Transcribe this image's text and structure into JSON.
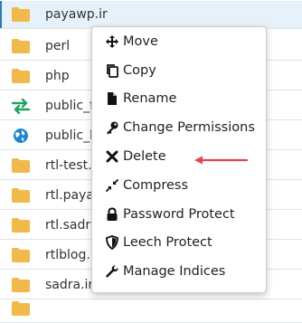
{
  "file_list": {
    "rows": [
      {
        "name": "payawp.ir",
        "icon": "folder-icon",
        "selected": true
      },
      {
        "name": "perl",
        "icon": "folder-icon"
      },
      {
        "name": "php",
        "icon": "folder-icon"
      },
      {
        "name": "public_f",
        "icon": "symlink-icon"
      },
      {
        "name": "public_h",
        "icon": "globe-icon"
      },
      {
        "name": "rtl-test.i",
        "icon": "folder-icon"
      },
      {
        "name": "rtl.paya",
        "icon": "folder-icon"
      },
      {
        "name": "rtl.sadra",
        "icon": "folder-icon"
      },
      {
        "name": "rtlblog.p",
        "icon": "folder-icon"
      },
      {
        "name": "sadra.ir",
        "icon": "folder-icon"
      },
      {
        "name": "",
        "icon": "folder-icon"
      }
    ]
  },
  "context_menu": {
    "items": [
      {
        "label": "Move",
        "icon": "move-icon"
      },
      {
        "label": "Copy",
        "icon": "copy-icon"
      },
      {
        "label": "Rename",
        "icon": "file-icon"
      },
      {
        "label": "Change Permissions",
        "icon": "key-icon"
      },
      {
        "label": "Delete",
        "icon": "delete-icon"
      },
      {
        "label": "Compress",
        "icon": "compress-icon"
      },
      {
        "label": "Password Protect",
        "icon": "lock-icon"
      },
      {
        "label": "Leech Protect",
        "icon": "shield-icon"
      },
      {
        "label": "Manage Indices",
        "icon": "wrench-icon"
      }
    ]
  },
  "annotation": {
    "icon": "arrow-left-icon",
    "color": "#e0454a"
  },
  "colors": {
    "folder": "#f0b94a",
    "symlink": "#1ea362",
    "globe": "#1e88d6",
    "selected_row": "#e6f1fa",
    "annotation_arrow": "#e0454a"
  }
}
